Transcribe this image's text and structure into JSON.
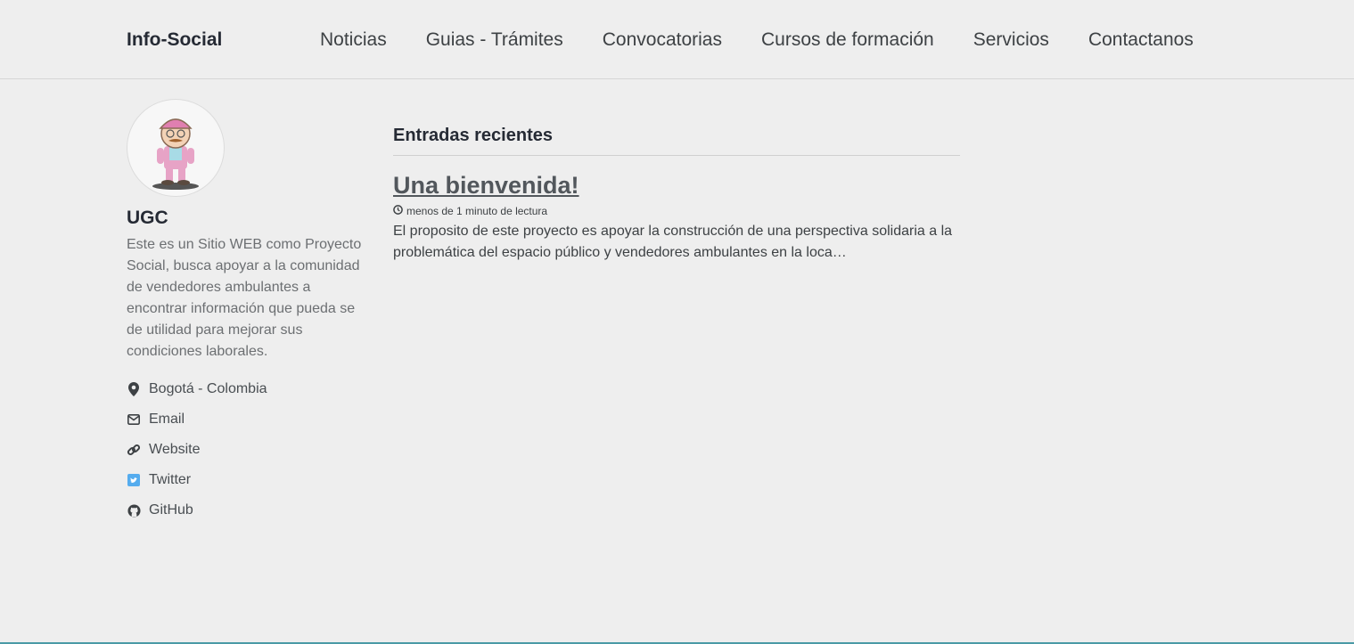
{
  "site": {
    "title": "Info-Social"
  },
  "nav": {
    "items": [
      "Noticias",
      "Guias - Trámites",
      "Convocatorias",
      "Cursos de formación",
      "Servicios",
      "Contactanos"
    ]
  },
  "author": {
    "name": "UGC",
    "bio": "Este es un Sitio WEB como Proyecto Social, busca apoyar a la comunidad de vendedores ambulantes a encontrar información que pueda se de utilidad para mejorar sus condiciones laborales.",
    "links": [
      {
        "icon": "map-marker-icon",
        "label": "Bogotá - Colombia"
      },
      {
        "icon": "envelope-icon",
        "label": "Email"
      },
      {
        "icon": "link-icon",
        "label": "Website"
      },
      {
        "icon": "twitter-icon",
        "label": "Twitter"
      },
      {
        "icon": "github-icon",
        "label": "GitHub"
      }
    ]
  },
  "main": {
    "section_title": "Entradas recientes",
    "posts": [
      {
        "title": "Una bienvenida!",
        "read_time": "menos de 1 minuto de lectura",
        "excerpt": "El proposito de este proyecto es apoyar la construcción de una perspectiva solidaria a la problemática del espacio público y vendedores ambulantes en la loca…"
      }
    ]
  },
  "colors": {
    "background": "#eeeeee",
    "text": "#3d4144",
    "twitter": "#55acee",
    "accent_line": "#4a9aa6"
  }
}
